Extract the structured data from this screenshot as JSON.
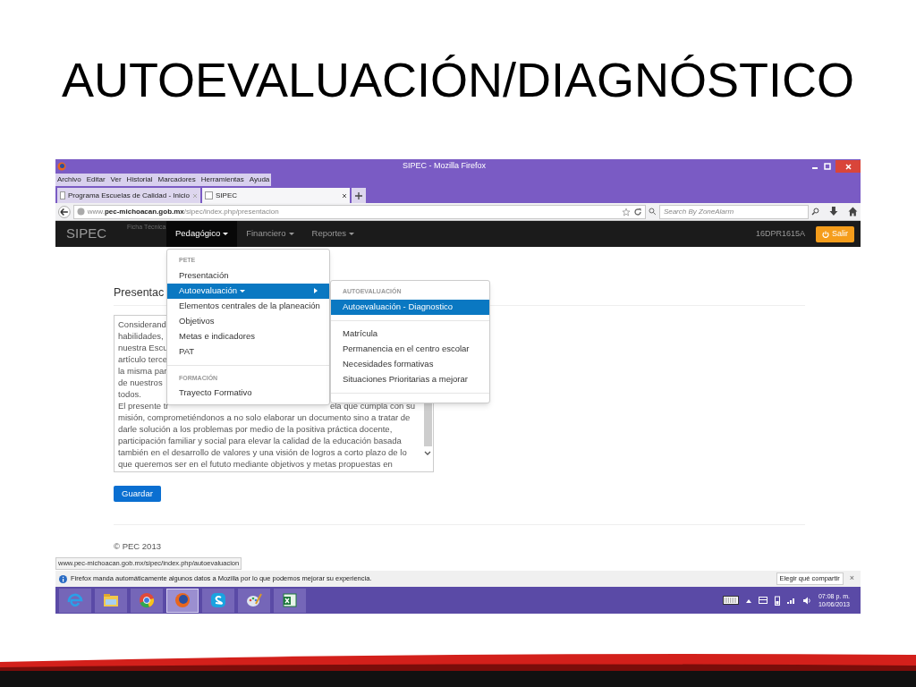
{
  "slide": {
    "title": "AUTOEVALUACIÓN/DIAGNÓSTICO"
  },
  "browser": {
    "title": "SIPEC - Mozilla Firefox",
    "menu": [
      "Archivo",
      "Editar",
      "Ver",
      "Historial",
      "Marcadores",
      "Herramientas",
      "Ayuda"
    ],
    "tabs": [
      {
        "label": "Programa Escuelas de Calidad - Inicio",
        "selected": false
      },
      {
        "label": "SIPEC",
        "selected": true
      }
    ],
    "url": {
      "prefix": "www.",
      "host": "pec-michoacan.gob.mx",
      "path": "/sipec/index.php/presentacion"
    },
    "search": {
      "placeholder": "Search By ZoneAlarm"
    }
  },
  "navbar": {
    "brand": "SIPEC",
    "faded_text": "Ficha Técnica",
    "items": [
      {
        "label": "Pedagógico",
        "selected": true
      },
      {
        "label": "Financiero",
        "selected": false
      },
      {
        "label": "Reportes",
        "selected": false
      }
    ],
    "user": "16DPR1615A",
    "logout": "Salir"
  },
  "page": {
    "heading": "Presentac",
    "textarea_lines": [
      {
        "left": "Considerand"
      },
      {
        "left": "habilidades,"
      },
      {
        "left": "nuestra Escu"
      },
      {
        "left": "artículo terce"
      },
      {
        "left": "la misma par"
      },
      {
        "left": "de nuestros"
      },
      {
        "left": "todos."
      },
      {
        "left": "El presente tr",
        "right": "ela que cumpla con su"
      },
      {
        "left": "misión, comprometiéndonos a no solo elaborar un documento sino a tratar de"
      },
      {
        "left": "darle solución a los problemas por medio de la positiva práctica docente,"
      },
      {
        "left": "participación familiar y social para elevar la calidad de la educación basada"
      },
      {
        "left": "también en el desarrollo de valores y una visión de logros a corto plazo de lo"
      },
      {
        "left": "que queremos ser en el fututo mediante objetivos y metas propuestas en"
      }
    ],
    "save": "Guardar",
    "footer": "© PEC 2013"
  },
  "dropdown": [
    {
      "kind": "header",
      "label": "PETE"
    },
    {
      "kind": "item",
      "label": "Presentación",
      "selected": false,
      "submenu": false
    },
    {
      "kind": "item",
      "label": "Autoevaluación",
      "selected": true,
      "submenu": true
    },
    {
      "kind": "item",
      "label": "Elementos centrales de la planeación",
      "selected": false,
      "submenu": false
    },
    {
      "kind": "item",
      "label": "Objetivos",
      "selected": false,
      "submenu": false
    },
    {
      "kind": "item",
      "label": "Metas e indicadores",
      "selected": false,
      "submenu": false
    },
    {
      "kind": "item",
      "label": "PAT",
      "selected": false,
      "submenu": false
    },
    {
      "kind": "divider"
    },
    {
      "kind": "header",
      "label": "FORMACIÓN"
    },
    {
      "kind": "item",
      "label": "Trayecto Formativo",
      "selected": false,
      "submenu": false
    }
  ],
  "submenu": [
    {
      "kind": "header",
      "label": "AUTOEVALUACIÓN"
    },
    {
      "kind": "item",
      "label": "Autoevaluación - Diagnostico",
      "selected": true,
      "submenu": false
    },
    {
      "kind": "divider"
    },
    {
      "kind": "item",
      "label": "Matrícula",
      "selected": false,
      "submenu": false
    },
    {
      "kind": "item",
      "label": "Permanencia en el centro escolar",
      "selected": false,
      "submenu": false
    },
    {
      "kind": "item",
      "label": "Necesidades formativas",
      "selected": false,
      "submenu": false
    },
    {
      "kind": "item",
      "label": "Situaciones Prioritarias a mejorar",
      "selected": false,
      "submenu": false
    },
    {
      "kind": "divider"
    }
  ],
  "status_url": "www.pec-michoacan.gob.mx/sipec/index.php/autoevaluacion",
  "notification": {
    "text": "Firefox manda automáticamente algunos datos a Mozilla por lo que podemos mejorar su experiencia.",
    "button": "Elegir qué compartir",
    "close": "×"
  },
  "taskbar": {
    "apps": [
      {
        "kind": "ie",
        "selected": false
      },
      {
        "kind": "folder",
        "selected": false
      },
      {
        "kind": "chrome",
        "selected": false
      },
      {
        "kind": "firefox",
        "selected": true
      },
      {
        "kind": "skype",
        "selected": false
      },
      {
        "kind": "paint",
        "selected": false
      },
      {
        "kind": "excel",
        "selected": false
      }
    ],
    "time": "07:08 p. m.",
    "date": "10/06/2013"
  }
}
